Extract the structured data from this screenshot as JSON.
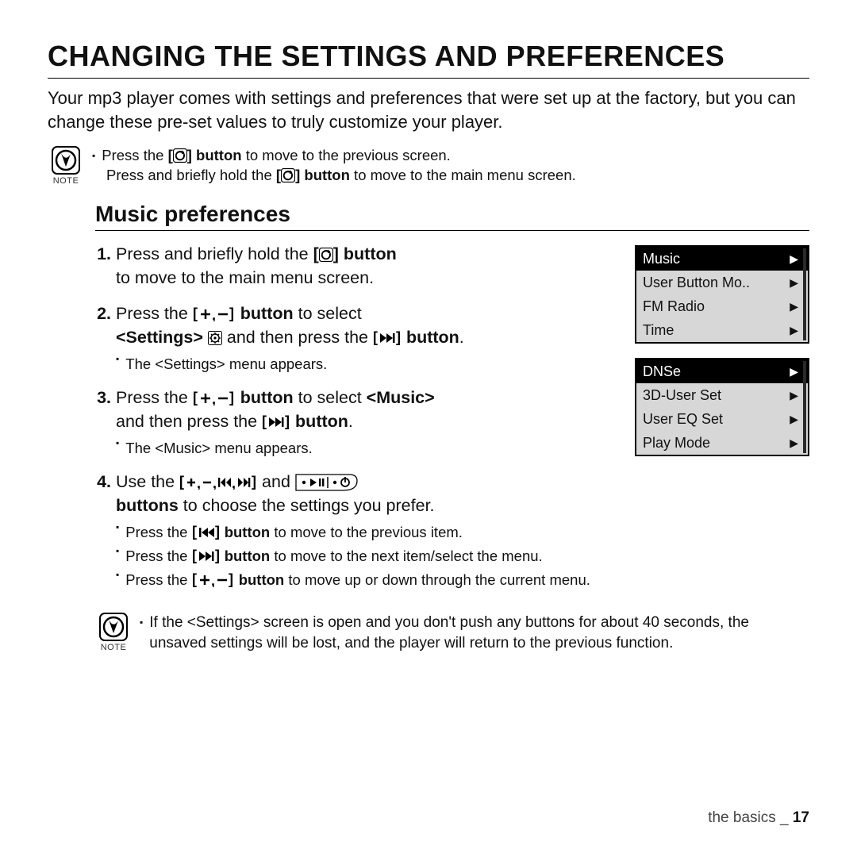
{
  "title": "CHANGING THE SETTINGS AND PREFERENCES",
  "intro": "Your mp3 player comes with settings and preferences that were set up at the factory, but you can change these pre-set values to truly customize your player.",
  "note_label": "NOTE",
  "note1_line1_a": "Press the ",
  "note1_line1_b": " button",
  "note1_line1_c": " to move to the previous screen.",
  "note1_line2_a": "Press and briefly hold the ",
  "note1_line2_b": " button",
  "note1_line2_c": " to move to the main menu screen.",
  "subtitle": "Music preferences",
  "steps": {
    "s1a": "Press and briefly hold the ",
    "s1b": " button",
    "s1c": " to move to the main menu screen.",
    "s2a": "Press the ",
    "s2b": " button",
    "s2c": " to select ",
    "s2d": "<Settings>",
    "s2e": " and then press the ",
    "s2f": " button",
    "s2g": ".",
    "s2_sub": "The <Settings> menu appears.",
    "s3a": "Press the ",
    "s3b": " button",
    "s3c": " to select ",
    "s3d": "<Music>",
    "s3e": " and then press the ",
    "s3f": " button",
    "s3g": ".",
    "s3_sub": "The <Music> menu appears.",
    "s4a": "Use the ",
    "s4b": " and ",
    "s4c": "buttons",
    "s4d": " to choose the settings you prefer.",
    "s4_sub1_a": "Press the ",
    "s4_sub1_b": " button",
    "s4_sub1_c": " to move to the previous item.",
    "s4_sub2_a": "Press the ",
    "s4_sub2_b": " button",
    "s4_sub2_c": " to move to the next item/select the menu.",
    "s4_sub3_a": "Press the ",
    "s4_sub3_b": " button",
    "s4_sub3_c": " to move up or down through the current menu."
  },
  "note2": "If the <Settings> screen is open and you don't push any buttons for about 40 seconds, the unsaved settings will be lost, and the player will return to the previous function.",
  "screen1": [
    "Music",
    "User Button Mo..",
    "FM Radio",
    "Time"
  ],
  "screen2": [
    "DNSe",
    "3D-User Set",
    "User EQ Set",
    "Play Mode"
  ],
  "footer_section": "the basics _ ",
  "footer_page": "17"
}
